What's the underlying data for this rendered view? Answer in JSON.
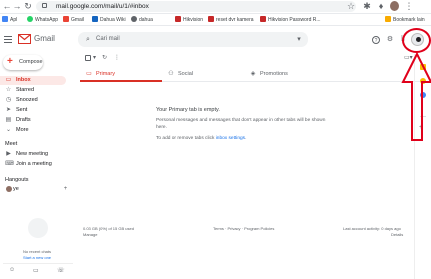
{
  "browser": {
    "url": "mail.google.com/mail/u/1/#inbox",
    "bookmarks": [
      "Apl",
      "WhatsApp",
      "Gmail",
      "Dahua Wiki",
      "dahua",
      "Hikvision",
      "reset dvr kamera",
      "Hikvision Password R...",
      "Bookmark lain"
    ]
  },
  "header": {
    "app_name": "Gmail",
    "search_placeholder": "Cari mail"
  },
  "sidebar": {
    "compose_label": "Compose",
    "items": [
      {
        "label": "Inbox",
        "icon": "inbox-icon"
      },
      {
        "label": "Starred",
        "icon": "star-icon"
      },
      {
        "label": "Snoozed",
        "icon": "clock-icon"
      },
      {
        "label": "Sent",
        "icon": "send-icon"
      },
      {
        "label": "Drafts",
        "icon": "draft-icon"
      },
      {
        "label": "More",
        "icon": "chevron-down-icon"
      }
    ],
    "meet_heading": "Meet",
    "meet_items": [
      {
        "label": "New meeting",
        "icon": "video-icon"
      },
      {
        "label": "Join a meeting",
        "icon": "keyboard-icon"
      }
    ],
    "hangouts_heading": "Hangouts",
    "hangouts_user": "ye",
    "no_chats_line1": "No recent chats",
    "no_chats_line2": "Start a new one"
  },
  "tabs": [
    {
      "label": "Primary",
      "icon": "inbox-icon"
    },
    {
      "label": "Social",
      "icon": "people-icon"
    },
    {
      "label": "Promotions",
      "icon": "tag-icon"
    }
  ],
  "empty_state": {
    "title": "Your Primary tab is empty.",
    "body": "Personal messages and messages that don't appear in other tabs will be shown here.",
    "settings_prefix": "To add or remove tabs click ",
    "settings_link": "inbox settings",
    "settings_suffix": "."
  },
  "footer": {
    "storage_line1": "0.03 GB (0%) of 15 GB used",
    "storage_line2": "Manage",
    "links": "Terms · Privacy · Program Policies",
    "activity_line1": "Last account activity: 0 days ago",
    "activity_line2": "Details"
  },
  "colors": {
    "accent": "#d93025",
    "annotation": "#e0001a"
  }
}
